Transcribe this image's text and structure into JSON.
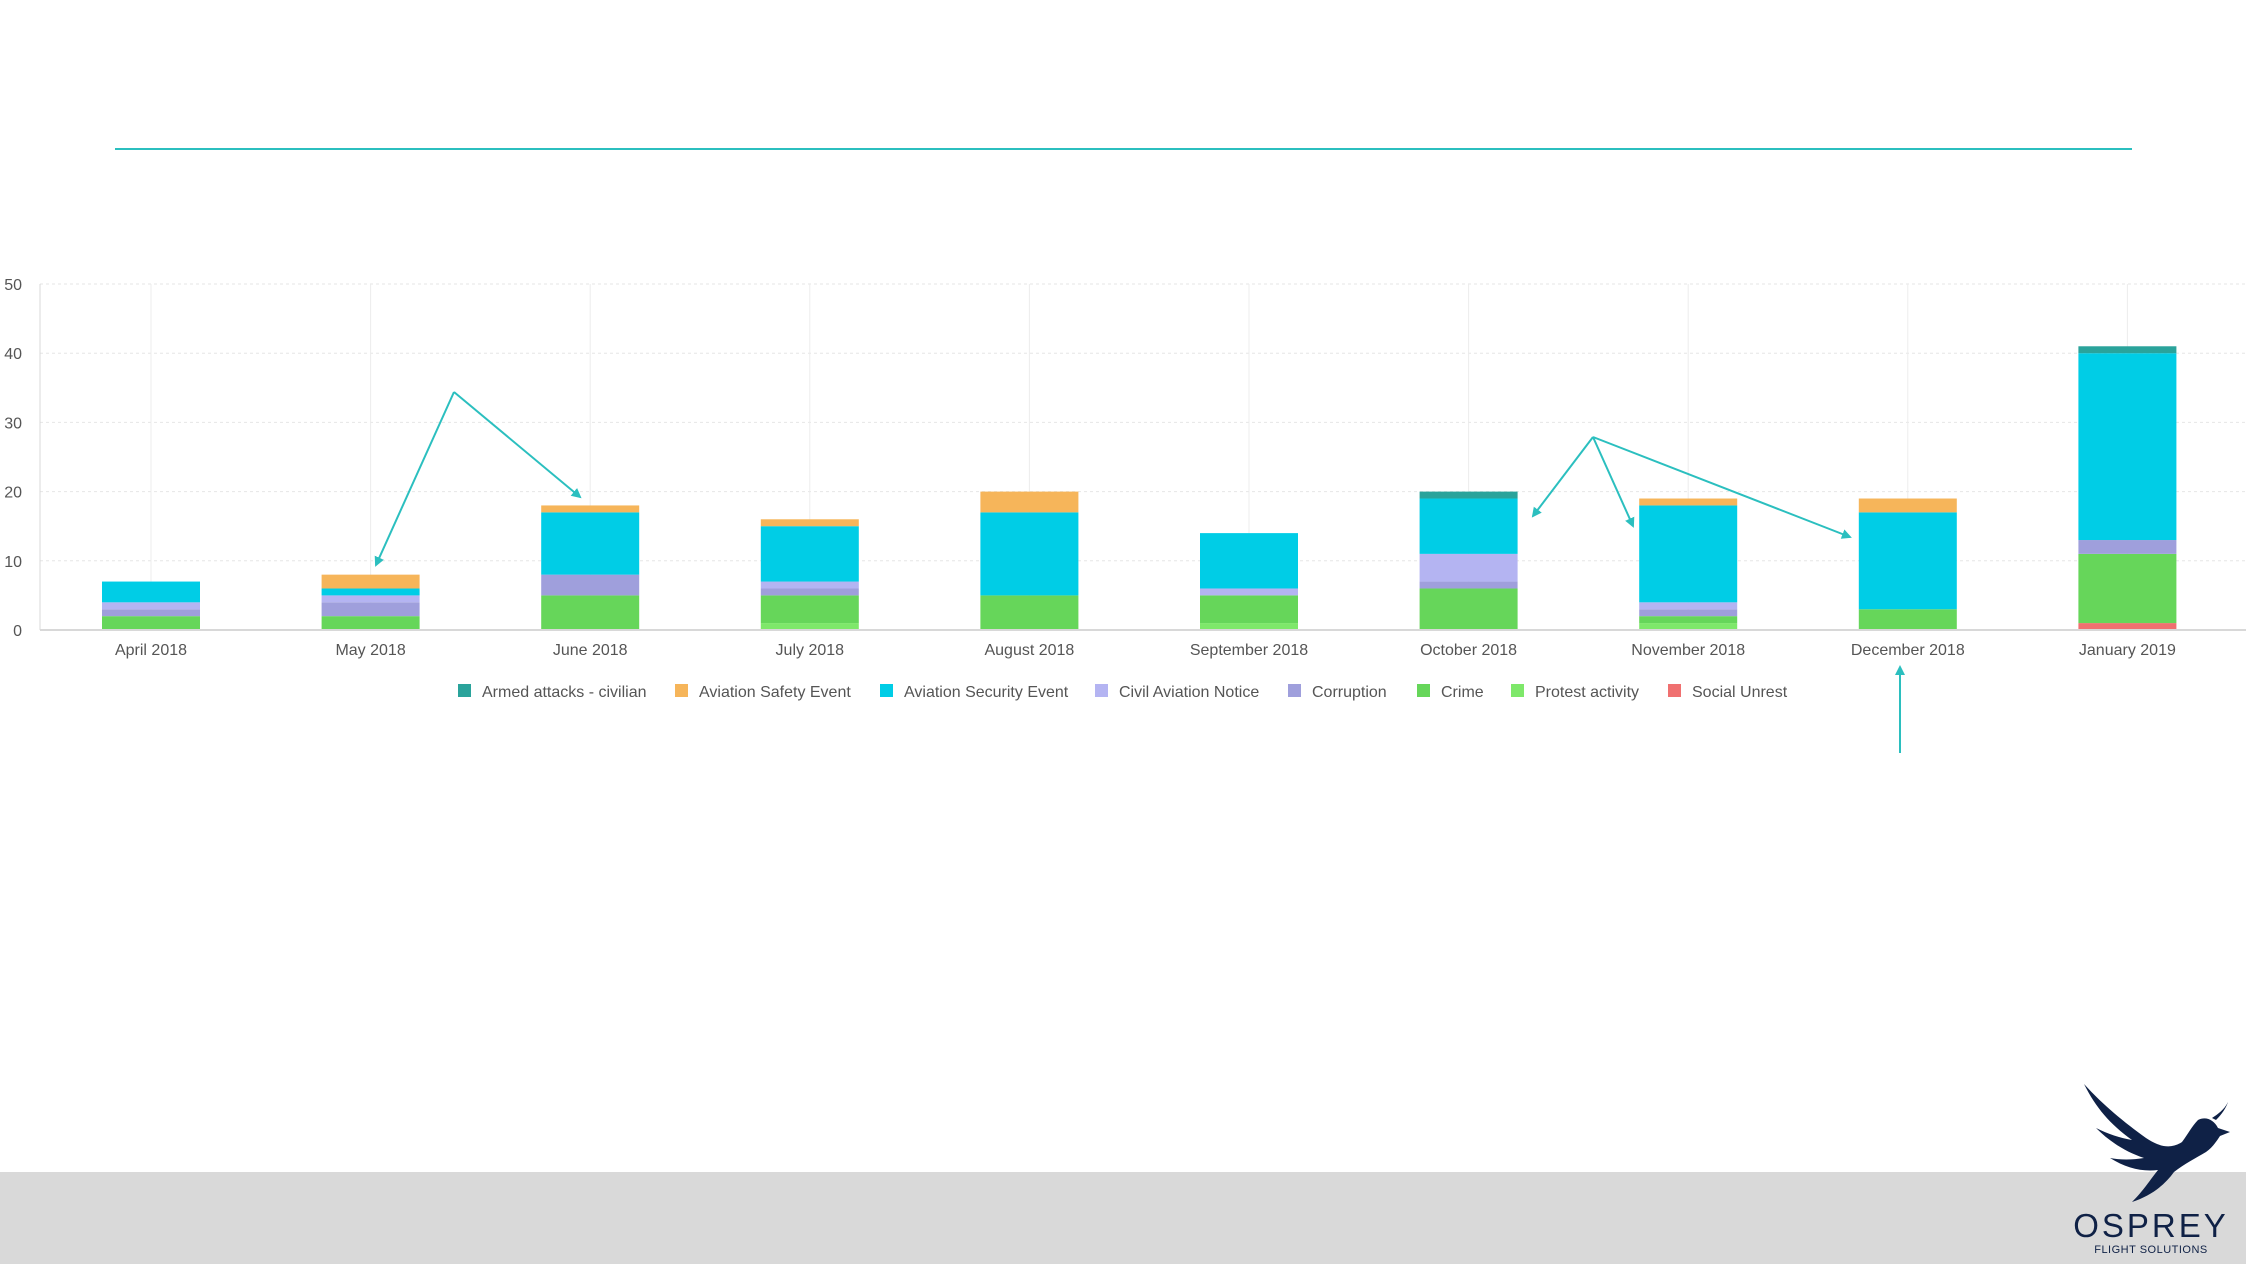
{
  "brand": {
    "name": "OSPREY",
    "tagline": "FLIGHT SOLUTIONS"
  },
  "chart_data": {
    "type": "bar",
    "stacked": true,
    "categories": [
      "April 2018",
      "May 2018",
      "June 2018",
      "July 2018",
      "August 2018",
      "September 2018",
      "October 2018",
      "November 2018",
      "December 2018",
      "January 2019"
    ],
    "ylim": [
      0,
      50
    ],
    "yticks": [
      0,
      10,
      20,
      30,
      40,
      50
    ],
    "grid": true,
    "legend_position": "bottom",
    "series": [
      {
        "name": "Social Unrest",
        "color": "#f07070",
        "values": [
          0,
          0,
          0,
          0,
          0,
          0,
          0,
          0,
          0,
          1
        ]
      },
      {
        "name": "Protest activity",
        "color": "#7ee86a",
        "values": [
          0,
          0,
          0,
          1,
          0,
          1,
          0,
          1,
          0,
          0
        ]
      },
      {
        "name": "Crime",
        "color": "#66d65a",
        "values": [
          2,
          2,
          5,
          4,
          5,
          4,
          6,
          1,
          3,
          10
        ]
      },
      {
        "name": "Corruption",
        "color": "#9f9fdc",
        "values": [
          1,
          2,
          3,
          1,
          0,
          0,
          1,
          1,
          0,
          2
        ]
      },
      {
        "name": "Civil Aviation Notice",
        "color": "#b4b4f2",
        "values": [
          1,
          1,
          0,
          1,
          0,
          1,
          4,
          1,
          0,
          0
        ]
      },
      {
        "name": "Aviation Security Event",
        "color": "#00cde6",
        "values": [
          3,
          1,
          9,
          8,
          12,
          8,
          8,
          14,
          14,
          27
        ]
      },
      {
        "name": "Aviation Safety Event",
        "color": "#f6b55a",
        "values": [
          0,
          2,
          1,
          1,
          3,
          0,
          0,
          1,
          2,
          0
        ]
      },
      {
        "name": "Armed attacks - civilian",
        "color": "#2aa39b",
        "values": [
          0,
          0,
          0,
          0,
          0,
          0,
          1,
          0,
          0,
          1
        ]
      }
    ],
    "legend_order": [
      "Armed attacks - civilian",
      "Aviation Safety Event",
      "Aviation Security Event",
      "Civil Aviation Notice",
      "Corruption",
      "Crime",
      "Protest activity",
      "Social Unrest"
    ]
  },
  "accent_color": "#2bbfbf"
}
